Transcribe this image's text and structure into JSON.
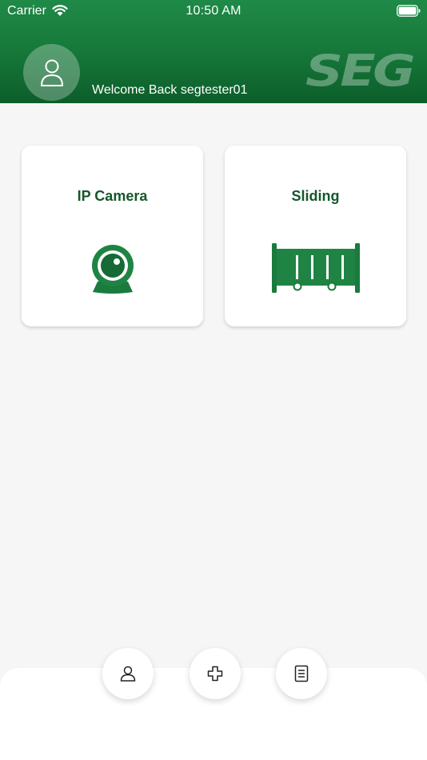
{
  "status_bar": {
    "carrier": "Carrier",
    "time": "10:50 AM"
  },
  "header": {
    "welcome": "Welcome Back segtester01",
    "logo_text": "SEG"
  },
  "cards": [
    {
      "label": "IP Camera",
      "icon": "webcam-icon"
    },
    {
      "label": "Sliding",
      "icon": "sliding-gate-icon"
    }
  ],
  "bottom_nav": [
    {
      "icon": "profile-icon"
    },
    {
      "icon": "add-icon"
    },
    {
      "icon": "document-icon"
    }
  ],
  "colors": {
    "brand_green": "#177a3b",
    "dark_green": "#14572a"
  }
}
